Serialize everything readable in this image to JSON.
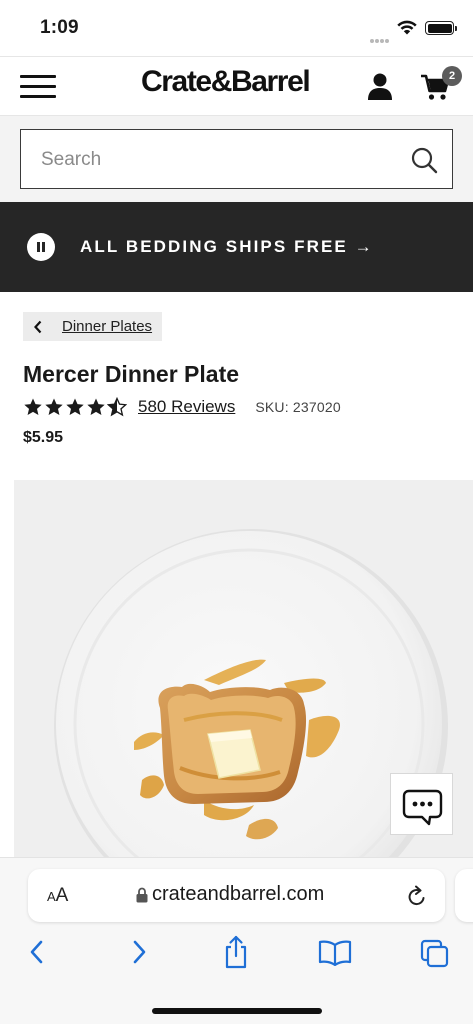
{
  "status_bar": {
    "time": "1:09"
  },
  "header": {
    "logo": "Crate&Barrel",
    "cart_count": "2"
  },
  "search": {
    "placeholder": "Search"
  },
  "promo": {
    "text": "ALL BEDDING SHIPS FREE →"
  },
  "breadcrumb": {
    "label": "Dinner Plates"
  },
  "product": {
    "title": "Mercer Dinner Plate",
    "rating": 4.5,
    "reviews_label": "580 Reviews",
    "sku": "SKU: 237020",
    "price": "$5.95"
  },
  "browser": {
    "aa_label_small": "A",
    "aa_label_large": "A",
    "url": "crateandbarrel.com"
  },
  "colors": {
    "promo_bg": "#262626",
    "link_blue": "#1f6fd6",
    "badge_bg": "#5c5c5c"
  }
}
